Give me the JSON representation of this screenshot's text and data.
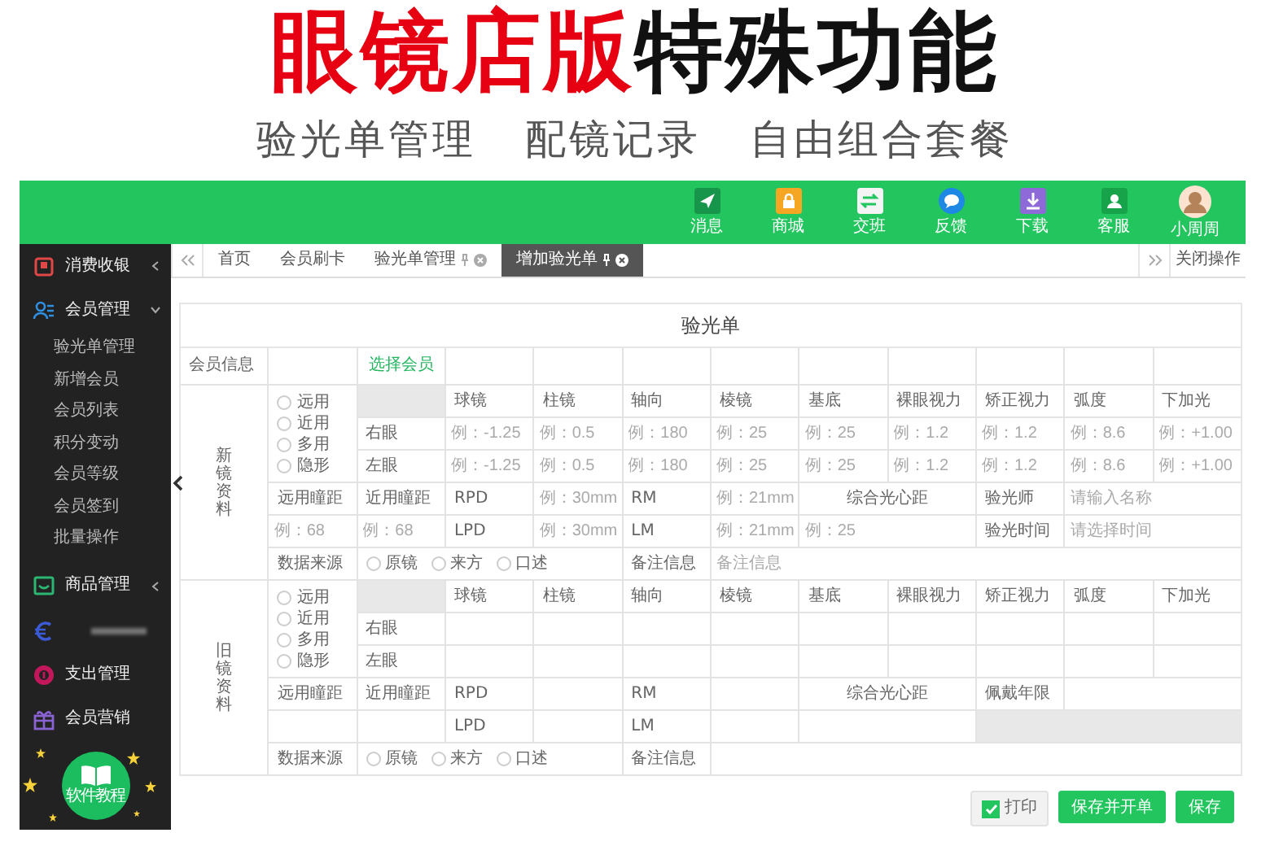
{
  "banner": {
    "title": [
      {
        "text": "眼镜店版",
        "kind": "accent"
      },
      {
        "text": "特殊功能",
        "kind": "plain"
      }
    ],
    "features": [
      "验光单管理",
      "配镜记录",
      "自由组合套餐"
    ]
  },
  "topbar": {
    "items": [
      {
        "label": "消息",
        "color": "#17954a"
      },
      {
        "label": "商城",
        "color": "#f5a623"
      },
      {
        "label": "交班",
        "color": "#f4f4f4"
      },
      {
        "label": "反馈",
        "color": "#1e88e5"
      },
      {
        "label": "下载",
        "color": "#8e6ad8"
      },
      {
        "label": "客服",
        "color": "#16a34a"
      }
    ],
    "user": {
      "name": "小周周"
    }
  },
  "sidebar": {
    "items": [
      {
        "kind": "group",
        "color": "#e04848",
        "label": "消费收银",
        "expanded": false
      },
      {
        "kind": "group",
        "color": "#2f8fe0",
        "label": "会员管理",
        "expanded": true,
        "children": [
          {
            "label": "验光单管理"
          },
          {
            "label": "新增会员"
          },
          {
            "label": "会员列表"
          },
          {
            "label": "积分变动"
          },
          {
            "label": "会员等级"
          },
          {
            "label": "会员签到"
          },
          {
            "label": "批量操作"
          }
        ]
      },
      {
        "kind": "group",
        "color": "#2bb673",
        "label": "商品管理",
        "expanded": false
      },
      {
        "kind": "blurred",
        "color": "#3b5bd6"
      },
      {
        "kind": "link",
        "color": "#c2185b",
        "label": "支出管理"
      },
      {
        "kind": "link",
        "color": "#8a63d2",
        "label": "会员营销"
      }
    ],
    "tutorial": {
      "label": "软件教程"
    }
  },
  "tabs": {
    "items": [
      {
        "label": "首页",
        "selected": false,
        "closable": false
      },
      {
        "label": "会员刷卡",
        "selected": false,
        "closable": false
      },
      {
        "label": "验光单管理",
        "selected": false,
        "closable": true
      },
      {
        "label": "增加验光单",
        "selected": true,
        "closable": true
      }
    ],
    "close_label": "关闭操作"
  },
  "form": {
    "title": "验光单",
    "member_row": {
      "label": "会员信息",
      "action": "选择会员"
    },
    "sections": [
      {
        "label": "新镜资料",
        "usage_options": [
          {
            "label": "远用",
            "selected": false
          },
          {
            "label": "近用",
            "selected": false
          },
          {
            "label": "多用",
            "selected": false
          },
          {
            "label": "隐形",
            "selected": false
          }
        ],
        "columns": [
          "球镜",
          "柱镜",
          "轴向",
          "棱镜",
          "基底",
          "裸眼视力",
          "矫正视力",
          "弧度",
          "下加光"
        ],
        "eyes": [
          {
            "label": "右眼",
            "values": [
              {
                "placeholder": "例：-1.25"
              },
              {
                "placeholder": "例：0.5"
              },
              {
                "placeholder": "例：180"
              },
              {
                "placeholder": "例：25"
              },
              {
                "placeholder": "例：25"
              },
              {
                "placeholder": "例：1.2"
              },
              {
                "placeholder": "例：1.2"
              },
              {
                "placeholder": "例：8.6"
              },
              {
                "placeholder": "例：+1.00"
              }
            ]
          },
          {
            "label": "左眼",
            "values": [
              {
                "placeholder": "例：-1.25"
              },
              {
                "placeholder": "例：0.5"
              },
              {
                "placeholder": "例：180"
              },
              {
                "placeholder": "例：25"
              },
              {
                "placeholder": "例：25"
              },
              {
                "placeholder": "例：1.2"
              },
              {
                "placeholder": "例：1.2"
              },
              {
                "placeholder": "例：8.6"
              },
              {
                "placeholder": "例：+1.00"
              }
            ]
          }
        ],
        "pd": {
          "far_label": "远用瞳距",
          "near_label": "近用瞳距",
          "far": {
            "placeholder": "例：68"
          },
          "near": {
            "placeholder": "例：68"
          },
          "rpd_label": "RPD",
          "rpd": {
            "placeholder": "例：30mm"
          },
          "rm_label": "RM",
          "rm": {
            "placeholder": "例：21mm"
          },
          "lpd_label": "LPD",
          "lpd": {
            "placeholder": "例：30mm"
          },
          "lm_label": "LM",
          "lm": {
            "placeholder": "例：21mm"
          },
          "center_label": "综合光心距",
          "center": {
            "placeholder": "例：25"
          }
        },
        "record_fields": [
          {
            "label": "验光师",
            "placeholder": "请输入名称",
            "disabled": false
          },
          {
            "label": "验光时间",
            "placeholder": "请选择时间",
            "disabled": false
          }
        ],
        "source": {
          "label": "数据来源",
          "options": [
            {
              "label": "原镜",
              "selected": false
            },
            {
              "label": "来方",
              "selected": false
            },
            {
              "label": "口述",
              "selected": false
            }
          ],
          "note_label": "备注信息",
          "note": {
            "placeholder": "备注信息"
          }
        }
      },
      {
        "label": "旧镜资料",
        "usage_options": [
          {
            "label": "远用",
            "selected": false
          },
          {
            "label": "近用",
            "selected": false
          },
          {
            "label": "多用",
            "selected": false
          },
          {
            "label": "隐形",
            "selected": false
          }
        ],
        "columns": [
          "球镜",
          "柱镜",
          "轴向",
          "棱镜",
          "基底",
          "裸眼视力",
          "矫正视力",
          "弧度",
          "下加光"
        ],
        "eyes": [
          {
            "label": "右眼"
          },
          {
            "label": "左眼"
          }
        ],
        "pd": {
          "far_label": "远用瞳距",
          "near_label": "近用瞳距",
          "rpd_label": "RPD",
          "rm_label": "RM",
          "lpd_label": "LPD",
          "lm_label": "LM",
          "center_label": "综合光心距"
        },
        "record_fields": [
          {
            "label": "佩戴年限",
            "disabled": false
          },
          {
            "disabled": true
          }
        ],
        "source": {
          "label": "数据来源",
          "options": [
            {
              "label": "原镜",
              "selected": false
            },
            {
              "label": "来方",
              "selected": false
            },
            {
              "label": "口述",
              "selected": false
            }
          ],
          "note_label": "备注信息"
        }
      }
    ],
    "footer": {
      "print": {
        "label": "打印",
        "checked": true
      },
      "buttons": [
        {
          "label": "保存并开单"
        },
        {
          "label": "保存"
        }
      ]
    }
  }
}
